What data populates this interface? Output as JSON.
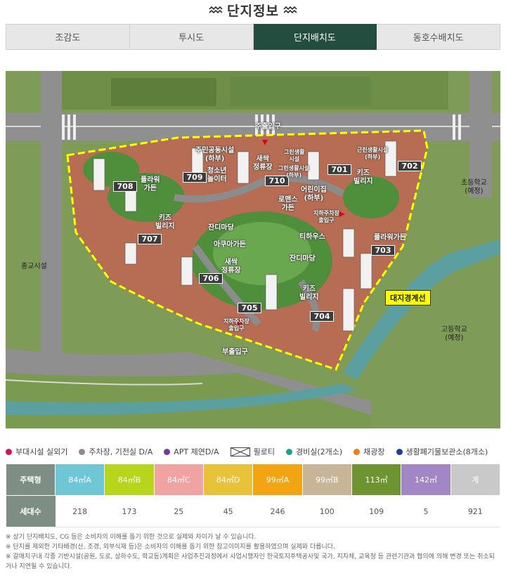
{
  "page_title": "단지정보",
  "tabs": [
    {
      "label": "조감도",
      "active": false
    },
    {
      "label": "투시도",
      "active": false
    },
    {
      "label": "단지배치도",
      "active": true
    },
    {
      "label": "동호수배치도",
      "active": false
    }
  ],
  "map": {
    "entrances": {
      "main": "주출입구",
      "sub": "부출입구"
    },
    "surroundings": {
      "left": "종교시설",
      "elementary": "초등학교\n(예정)",
      "highschool": "고등학교\n(예정)"
    },
    "boundary_label": "대지경계선",
    "buildings": [
      "701",
      "702",
      "703",
      "704",
      "705",
      "706",
      "707",
      "708",
      "709",
      "710"
    ],
    "facilities": {
      "community": "주민공동시설\n(하부)",
      "youth": "청소년\n놀이터",
      "saessak_top": "새싹\n정류장",
      "saessak_bottom": "새싹\n정류장",
      "kids1": "키즈\n빌리지",
      "kids2": "키즈\n빌리지",
      "kids3": "키즈\n빌리지",
      "flower1": "플라워\n가든",
      "flower2": "플라워가든",
      "lawn1": "잔디마당",
      "lawn2": "잔디마당",
      "acacia": "아쿠아가든",
      "teahouse": "티하우스",
      "romance": "로맨스\n가든",
      "children": "어린이집\n(하부)",
      "parking_top": "지하주차장\n출입구",
      "parking_bottom": "지하주차장\n출입구",
      "greenlife1": "그린생활\n시설",
      "greenlife2": "그린생활시설\n(하부)",
      "greenlife3": "근린생활시설\n(하부)"
    }
  },
  "legend": [
    {
      "label": "부대시설 실외기",
      "color": "#d4145a",
      "shape": "dot"
    },
    {
      "label": "주차장, 기전실 D/A",
      "color": "#8c8c8c",
      "shape": "dot"
    },
    {
      "label": "APT 제연D/A",
      "color": "#6d3aa6",
      "shape": "dot"
    },
    {
      "label": "필로티",
      "color": "#444444",
      "shape": "box"
    },
    {
      "label": "경비실(2개소)",
      "color": "#1aa38a",
      "shape": "dot"
    },
    {
      "label": "채광창",
      "color": "#f07d13",
      "shape": "dot"
    },
    {
      "label": "생활폐기물보관소(8개소)",
      "color": "#1c3f9e",
      "shape": "dot"
    }
  ],
  "unit_table": {
    "type_header": "주택형",
    "count_header": "세대수",
    "columns": [
      {
        "type": "84㎡A",
        "count": "218",
        "color": "#6fc7d6"
      },
      {
        "type": "84㎡B",
        "count": "173",
        "color": "#b7d61b"
      },
      {
        "type": "84㎡C",
        "count": "25",
        "color": "#f0a3a1"
      },
      {
        "type": "84㎡D",
        "count": "45",
        "color": "#e8c33a"
      },
      {
        "type": "99㎡A",
        "count": "246",
        "color": "#f3a412"
      },
      {
        "type": "99㎡B",
        "count": "100",
        "color": "#c8b597"
      },
      {
        "type": "113㎡",
        "count": "109",
        "color": "#6e9432"
      },
      {
        "type": "142㎡",
        "count": "5",
        "color": "#a386c6"
      },
      {
        "type": "계",
        "count": "921",
        "color": "#c9c9c9"
      }
    ]
  },
  "notes": [
    "※ 상기 단지배치도, CG 등은 소비자의 이해를 돕기 위한 것으로 실제와 차이가 날 수 있습니다.",
    "※ 단지를 제외한 기타배경(산, 조경, 외부식재 등)은 소비자의 이해를 돕기 위한 참고이미지를 활용하였으며 실제와 다릅니다.",
    "※ 갈매지구내 각종 기반시설(공원, 도로, 상하수도, 학교등)계획은 사업추진과정에서 사업시행자인 한국토지주택공사및 국가, 지자체, 교육청 등 관련기관과 협의에 의해 변경 또는 취소되",
    "거나 지연될 수 있습니다."
  ]
}
